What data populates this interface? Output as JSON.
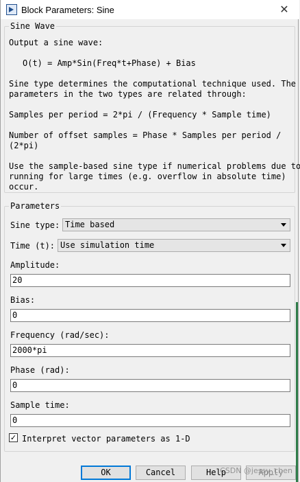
{
  "window": {
    "title": "Block Parameters: Sine",
    "close_icon": "close-icon"
  },
  "description": {
    "group_title": "Sine Wave",
    "lines": [
      "Output a sine wave:",
      "O(t) = Amp*Sin(Freq*t+Phase) + Bias",
      "Sine type determines the computational technique used. The",
      "parameters in the two types are related through:",
      "Samples per period = 2*pi / (Frequency * Sample time)",
      "Number of offset samples = Phase * Samples per period /",
      "(2*pi)",
      "Use the sample-based sine type if numerical problems due to",
      "running for large times (e.g. overflow in absolute time)",
      "occur."
    ]
  },
  "parameters": {
    "group_title": "Parameters",
    "sine_type": {
      "label": "Sine type:",
      "value": "Time based"
    },
    "time": {
      "label": "Time (t):",
      "value": "Use simulation time"
    },
    "amplitude": {
      "label": "Amplitude:",
      "value": "20"
    },
    "bias": {
      "label": "Bias:",
      "value": "0"
    },
    "frequency": {
      "label": "Frequency (rad/sec):",
      "value": "2000*pi"
    },
    "phase": {
      "label": "Phase (rad):",
      "value": "0"
    },
    "sample_time": {
      "label": "Sample time:",
      "value": "0"
    },
    "interpret_vector": {
      "label": "Interpret vector parameters as 1-D",
      "checked": true,
      "mark": "✓"
    }
  },
  "buttons": {
    "ok": "OK",
    "cancel": "Cancel",
    "help": "Help",
    "apply": "Apply"
  },
  "watermark": "CSDN @jessy_chen"
}
